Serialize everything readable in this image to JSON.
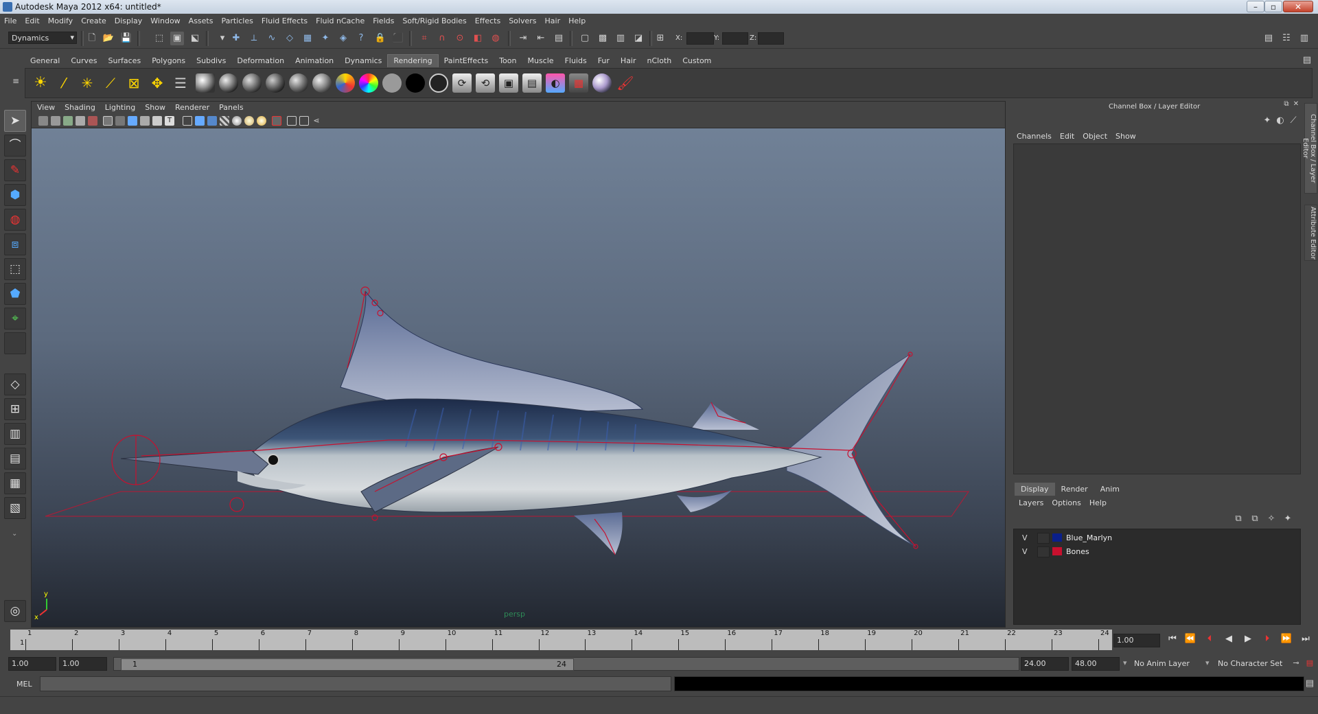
{
  "window": {
    "title": "Autodesk Maya 2012 x64: untitled*"
  },
  "menubar": [
    "File",
    "Edit",
    "Modify",
    "Create",
    "Display",
    "Window",
    "Assets",
    "Particles",
    "Fluid Effects",
    "Fluid nCache",
    "Fields",
    "Soft/Rigid Bodies",
    "Effects",
    "Solvers",
    "Hair",
    "Help"
  ],
  "statusline": {
    "menuset": "Dynamics",
    "x_label": "X:",
    "y_label": "Y:",
    "z_label": "Z:"
  },
  "shelf": {
    "tabs": [
      "General",
      "Curves",
      "Surfaces",
      "Polygons",
      "Subdivs",
      "Deformation",
      "Animation",
      "Dynamics",
      "Rendering",
      "PaintEffects",
      "Toon",
      "Muscle",
      "Fluids",
      "Fur",
      "Hair",
      "nCloth",
      "Custom"
    ],
    "active_tab": "Rendering"
  },
  "viewport": {
    "menus": [
      "View",
      "Shading",
      "Lighting",
      "Show",
      "Renderer",
      "Panels"
    ],
    "camera_label": "persp",
    "axis_y": "y",
    "axis_x": "x"
  },
  "channel_box": {
    "header": "Channel Box / Layer Editor",
    "menus": [
      "Channels",
      "Edit",
      "Object",
      "Show"
    ],
    "side_tabs": [
      "Channel Box / Layer Editor",
      "Attribute Editor"
    ]
  },
  "layer_editor": {
    "tabs": [
      "Display",
      "Render",
      "Anim"
    ],
    "active_tab": "Display",
    "menus": [
      "Layers",
      "Options",
      "Help"
    ],
    "layers": [
      {
        "visible": "V",
        "name": "Blue_Marlyn",
        "color": "#0a1f8a"
      },
      {
        "visible": "V",
        "name": "Bones",
        "color": "#c8102e"
      }
    ]
  },
  "time_slider": {
    "ticks": [
      "1",
      "2",
      "3",
      "4",
      "5",
      "6",
      "7",
      "8",
      "9",
      "10",
      "11",
      "12",
      "13",
      "14",
      "15",
      "16",
      "17",
      "18",
      "19",
      "20",
      "21",
      "22",
      "23",
      "24"
    ],
    "current_marker": "1",
    "current_time": "1.00"
  },
  "range_slider": {
    "start_time": "1.00",
    "playback_start": "1.00",
    "handle_start": "1",
    "handle_end": "24",
    "playback_end": "24.00",
    "end_time": "48.00",
    "anim_layer": "No Anim Layer",
    "character_set": "No Character Set"
  },
  "command_line": {
    "label": "MEL"
  },
  "colors": {
    "accent": "#c8102e",
    "background": "#444444"
  }
}
